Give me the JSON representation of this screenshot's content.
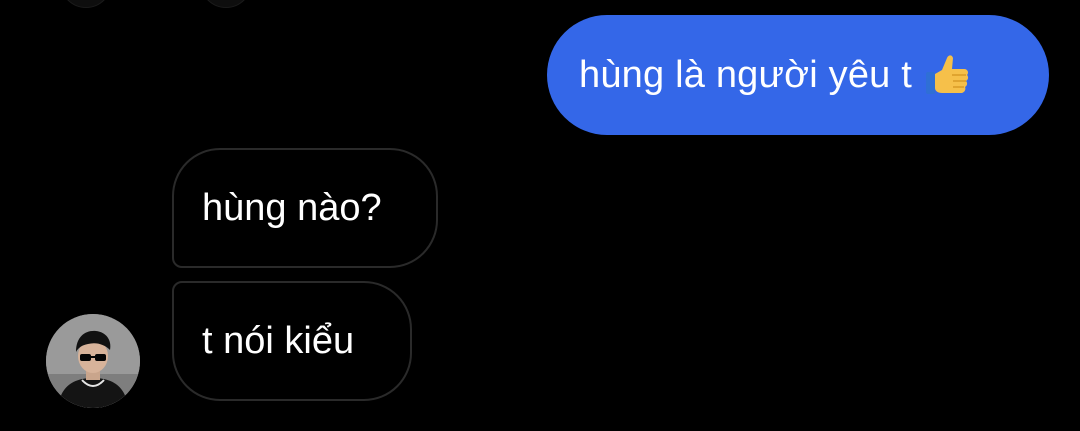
{
  "chat": {
    "messages": [
      {
        "direction": "sent",
        "text": "hùng là người yêu t",
        "emoji": "thumbs-up-icon"
      },
      {
        "direction": "received",
        "text": "hùng nào?"
      },
      {
        "direction": "received",
        "text": "t nói kiểu"
      }
    ]
  },
  "colors": {
    "background": "#000000",
    "sent_bubble": "#3467e8",
    "received_bubble_border": "#2a2a2a",
    "text": "#ffffff"
  }
}
